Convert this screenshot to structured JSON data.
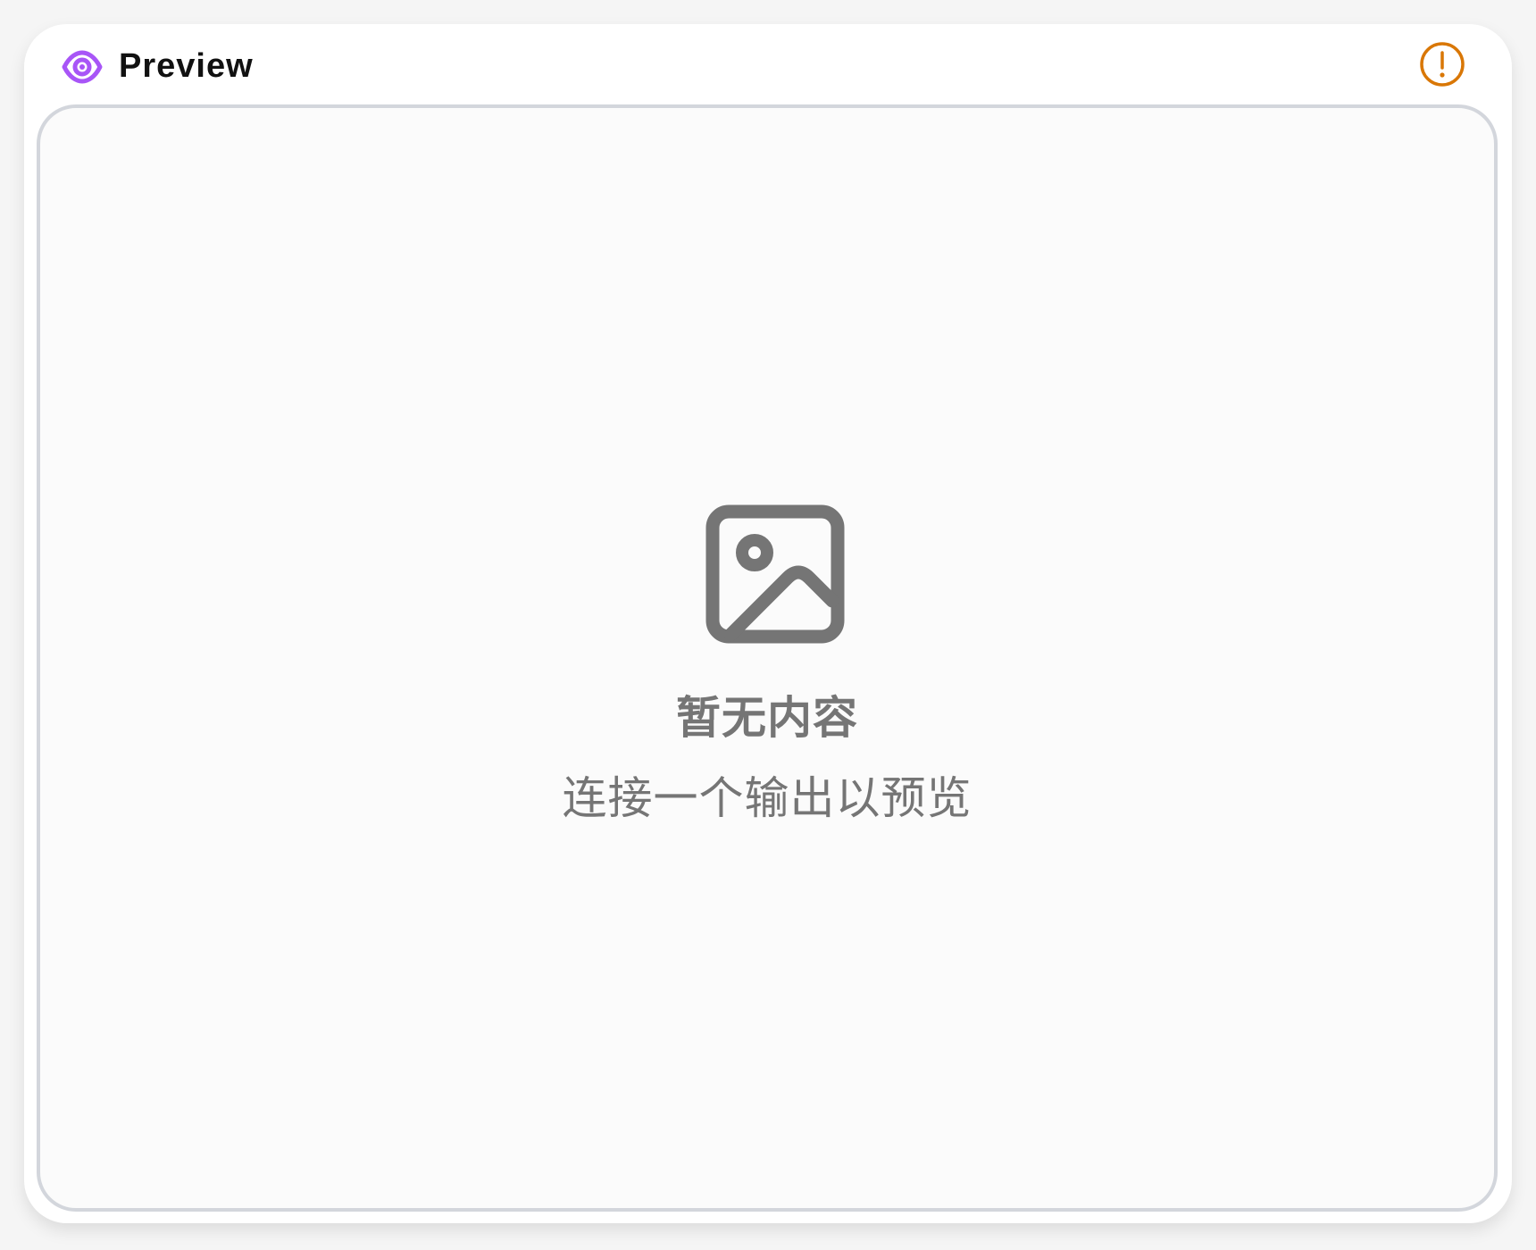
{
  "node": {
    "title": "Preview",
    "icon": "eye-icon",
    "status_icon": "warning-icon",
    "accent_color": "#a855f7",
    "warning_color": "#d97706"
  },
  "preview": {
    "empty_icon": "image-icon",
    "empty_title": "暂无内容",
    "empty_subtitle": "连接一个输出以预览",
    "text_color": "#757575",
    "border_color": "#d3d6dc"
  }
}
